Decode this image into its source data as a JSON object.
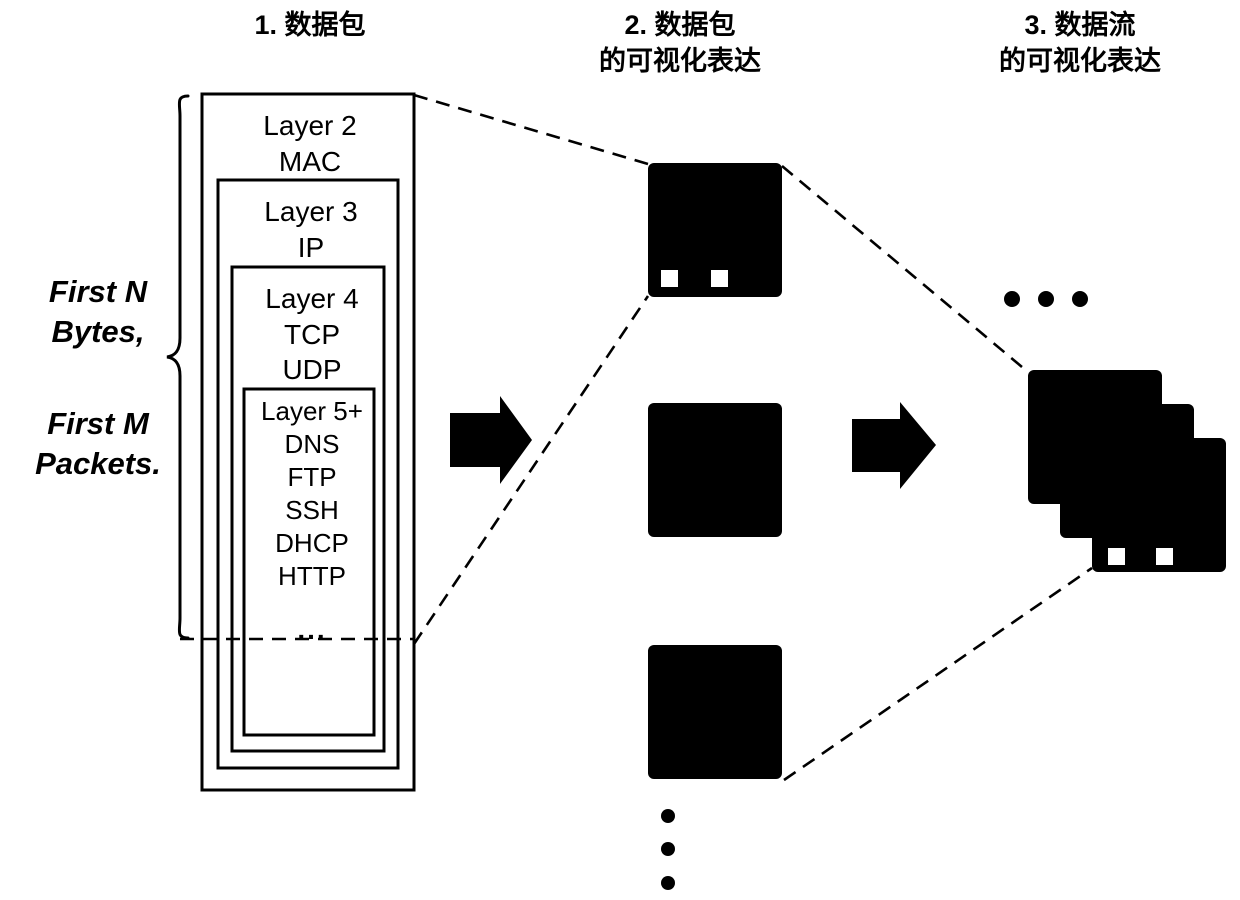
{
  "figure": {
    "background_color": "#ffffff",
    "ink_color": "#000000",
    "columns": [
      {
        "id": "packet",
        "title": "1.  数据包"
      },
      {
        "id": "packet_visual",
        "title": "2.  数据包\n的可视化表达"
      },
      {
        "id": "flow_visual",
        "title": "3.  数据流\n的可视化表达"
      }
    ]
  },
  "side_labels": {
    "bytes": "First N\nBytes,",
    "packets": "First M\nPackets."
  },
  "packet_stack": {
    "layers": [
      {
        "name": "Layer 2",
        "protocols": "MAC",
        "text": "Layer 2\nMAC"
      },
      {
        "name": "Layer 3",
        "protocols": "IP",
        "text": "Layer 3\nIP"
      },
      {
        "name": "Layer 4",
        "protocols": "TCP, UDP",
        "text": "Layer 4\nTCP\nUDP"
      },
      {
        "name": "Layer 5+",
        "protocols": "DNS, FTP, SSH, DHCP, HTTP",
        "text": "Layer 5+\nDNS\nFTP\nSSH\nDHCP\nHTTP"
      }
    ],
    "continuation": "..."
  },
  "packet_images": {
    "count_shown": 3,
    "first_image_markers": 2,
    "ellipsis": "⋮"
  },
  "flow_images": {
    "stacked_count": 3,
    "markers": 2,
    "ellipsis": "• • •"
  },
  "arrows": [
    {
      "id": "arrow-packet-to-image",
      "direction": "right"
    },
    {
      "id": "arrow-image-to-flow",
      "direction": "right"
    }
  ]
}
